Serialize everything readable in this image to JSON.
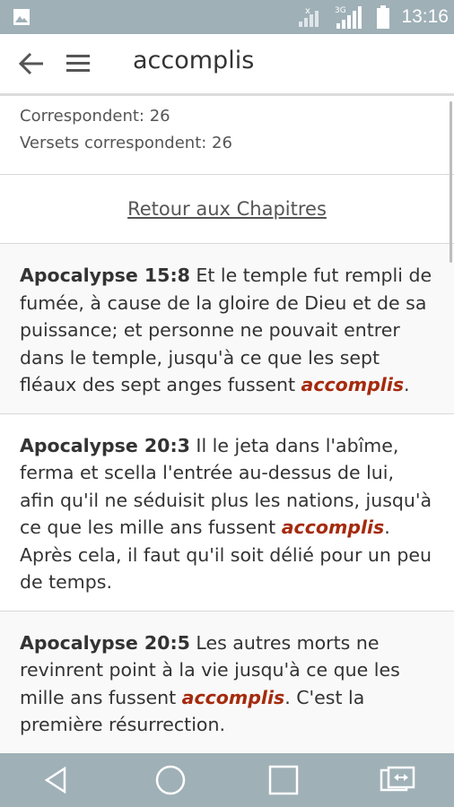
{
  "status_bar": {
    "time": "13:16",
    "network_label": "3G",
    "icons": [
      "image-icon",
      "signal-x-icon",
      "signal-3g-icon",
      "battery-icon"
    ]
  },
  "app_bar": {
    "title": "accomplis",
    "back_icon": "arrow-left-icon",
    "menu_icon": "hamburger-menu-icon"
  },
  "stats": {
    "matches": "Correspondent: 26",
    "verses_matches": "Versets correspondent: 26"
  },
  "retour_label": "Retour aux Chapitres",
  "highlight_word": "accomplis",
  "results": [
    {
      "ref": "Apocalypse 15:8",
      "before": " Et le temple fut rempli de fumée, à cause de la gloire de Dieu et de sa puissance; et personne ne pouvait entrer dans le temple, jusqu'à ce que les sept fléaux des sept anges fussent ",
      "after": "."
    },
    {
      "ref": "Apocalypse 20:3",
      "before": " Il le jeta dans l'abîme, ferma et scella l'entrée au-dessus de lui, afin qu'il ne séduisit plus les nations, jusqu'à ce que les mille ans fussent ",
      "after": ". Après cela, il faut qu'il soit délié pour un peu de temps."
    },
    {
      "ref": "Apocalypse 20:5",
      "before": " Les autres morts ne revinrent point à la vie jusqu'à ce que les mille ans fussent ",
      "after": ". C'est la première résurrection."
    }
  ],
  "nav_bar": {
    "icons": [
      "back-triangle-icon",
      "home-circle-icon",
      "recents-square-icon",
      "switch-screen-icon"
    ]
  },
  "colors": {
    "system_bar": "#9fb0b7",
    "highlight": "#a52a0d",
    "text": "#333333"
  }
}
